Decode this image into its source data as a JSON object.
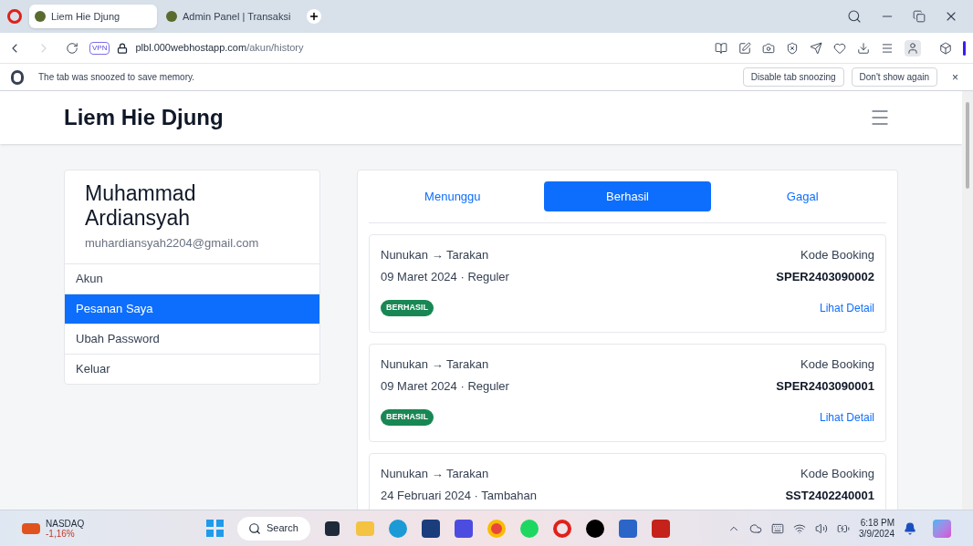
{
  "browser": {
    "tabs": [
      {
        "title": "Liem Hie Djung",
        "selected": true
      },
      {
        "title": "Admin Panel | Transaksi",
        "selected": false
      }
    ],
    "vpn_badge": "VPN",
    "url_host": "plbl.000webhostapp.com",
    "url_path": "/akun/history",
    "snooze_bar": {
      "message": "The tab was snoozed to save memory.",
      "buttons": [
        "Disable tab snoozing",
        "Don't show again"
      ],
      "close": "×"
    }
  },
  "site": {
    "brand": "Liem Hie Djung",
    "profile": {
      "name": "Muhammad Ardiansyah",
      "email": "muhardiansyah2204@gmail.com"
    },
    "menu": [
      {
        "label": "Akun",
        "selected": false
      },
      {
        "label": "Pesanan Saya",
        "selected": true
      },
      {
        "label": "Ubah Password",
        "selected": false
      },
      {
        "label": "Keluar",
        "selected": false
      }
    ],
    "status_tabs": [
      {
        "label": "Menunggu",
        "selected": false
      },
      {
        "label": "Berhasil",
        "selected": true
      },
      {
        "label": "Gagal",
        "selected": false
      }
    ],
    "bookings": [
      {
        "route": "Nunukan → Tarakan",
        "date_type": "09 Maret 2024 · Reguler",
        "code_label": "Kode Booking",
        "code": "SPER2403090002",
        "status": "BERHASIL",
        "detail_link": "Lihat Detail"
      },
      {
        "route": "Nunukan → Tarakan",
        "date_type": "09 Maret 2024 · Reguler",
        "code_label": "Kode Booking",
        "code": "SPER2403090001",
        "status": "BERHASIL",
        "detail_link": "Lihat Detail"
      },
      {
        "route": "Nunukan → Tarakan",
        "date_type": "24 Februari 2024 · Tambahan",
        "code_label": "Kode Booking",
        "code": "SST2402240001"
      }
    ]
  },
  "taskbar": {
    "widget": {
      "name": "NASDAQ",
      "change": "-1,16%"
    },
    "search": "Search",
    "clock": {
      "time": "6:18 PM",
      "date": "3/9/2024"
    }
  }
}
